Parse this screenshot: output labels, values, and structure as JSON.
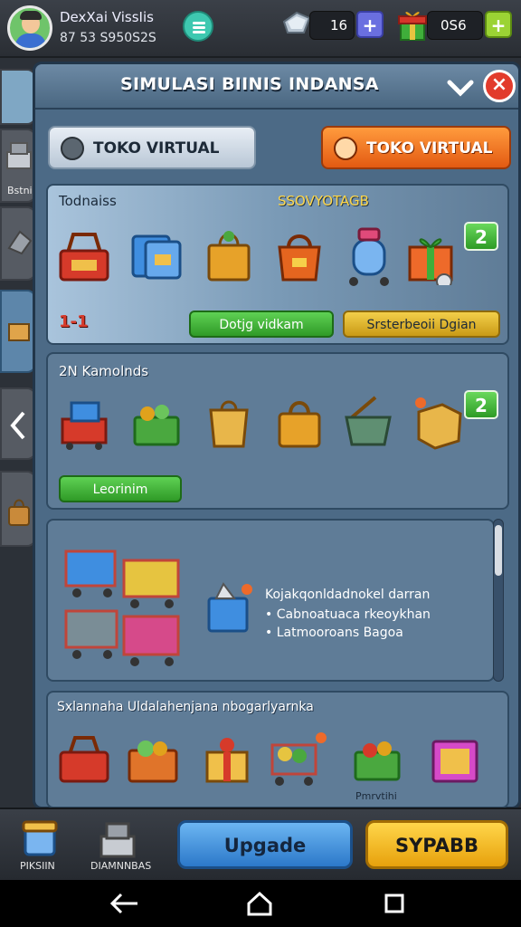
{
  "hud": {
    "player_name": "DexXai VissIis",
    "player_id": "87 53 S950S2S",
    "gems": "16",
    "gems_plus": "+",
    "coins": "0S6",
    "coins_plus": "+"
  },
  "sidebar": {
    "tab_label": "Bstni"
  },
  "panel": {
    "title": "SIMULASI BIINIS INDANSA",
    "close": "×",
    "tab_left": "TOKO VIRTUAL",
    "tab_right": "TOKO VIRTUAL"
  },
  "section1": {
    "title_left": "Todnaiss",
    "title_right": "SSOVYOTAGB",
    "counter": "1-1",
    "badge": "2",
    "btn_green": "Dotjg vidkam",
    "btn_yellow": "Srsterbeoii Dgian"
  },
  "section2": {
    "title": "2N Kamolnds",
    "badge": "2",
    "btn_green": "Leorinim"
  },
  "section3": {
    "line1": "Kojakqonldadnokel darran",
    "line2": "Cabnoatuaca rkeoykhan",
    "line3": "Latmooroans Bagoa"
  },
  "section4": {
    "title": "Sxlannaha Uldalahenjana nbogarlyarnka",
    "item_label": "Pmrvtihi"
  },
  "bottom": {
    "left_label": "PIKSIIN",
    "mid_label": "DIAMNNBAS",
    "upgrade": "Upgade",
    "yellow_btn": "SYPABB"
  },
  "colors": {
    "accent_orange": "#e35a12",
    "accent_green": "#2f9a27",
    "panel_blue": "#4c6a86",
    "close_red": "#e23b2c"
  }
}
